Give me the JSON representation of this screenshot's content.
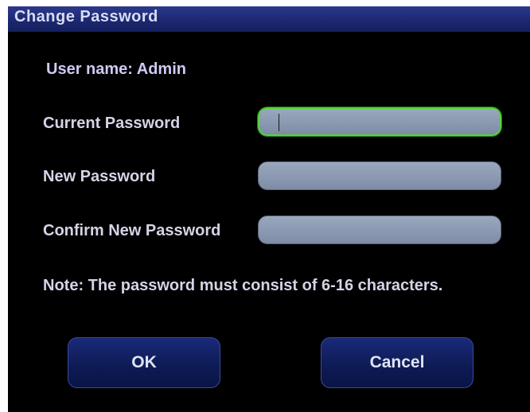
{
  "dialog": {
    "title": "Change Password"
  },
  "user": {
    "label": "User name: Admin"
  },
  "fields": {
    "current": {
      "label": "Current Password",
      "value": ""
    },
    "new": {
      "label": "New Password",
      "value": ""
    },
    "confirm": {
      "label": "Confirm New Password",
      "value": ""
    }
  },
  "note": "Note: The password must consist of 6-16 characters.",
  "buttons": {
    "ok": "OK",
    "cancel": "Cancel"
  },
  "colors": {
    "title_bar": "#1c2870",
    "focus_border": "#53d43a",
    "field_fill": "#8e9cb4",
    "button_fill": "#0d1a54"
  }
}
